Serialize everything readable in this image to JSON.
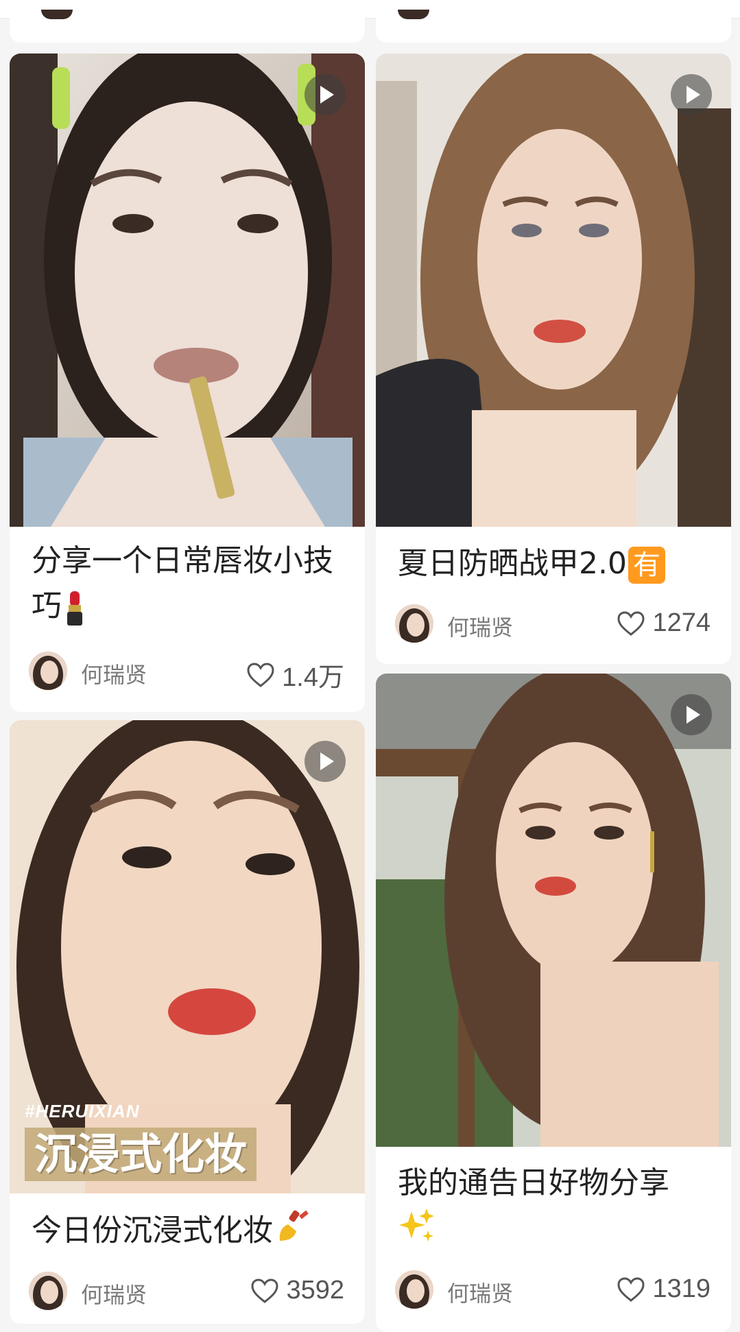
{
  "feed": {
    "cards": [
      {
        "title": "分享一个日常唇妆小技巧",
        "emoji": "lipstick-emoji",
        "author": "何瑞贤",
        "likes": "1.4万",
        "is_video": true
      },
      {
        "title": "夏日防晒战甲2.0",
        "badge": "有",
        "author": "何瑞贤",
        "likes": "1274",
        "is_video": true
      },
      {
        "title": "今日份沉浸式化妆",
        "emoji": "nail-polish-emoji",
        "author": "何瑞贤",
        "likes": "3592",
        "is_video": true,
        "overlay_tag": "#HERUIXIAN",
        "overlay_text": "沉浸式化妆"
      },
      {
        "title": "我的通告日好物分享",
        "emoji": "sparkles-emoji",
        "author": "何瑞贤",
        "likes": "1319",
        "is_video": true
      }
    ]
  },
  "colors": {
    "accent": "#ff2442",
    "background": "#f5f5f5",
    "card": "#ffffff",
    "title_text": "#222222",
    "meta_text": "#7a7a7a"
  }
}
